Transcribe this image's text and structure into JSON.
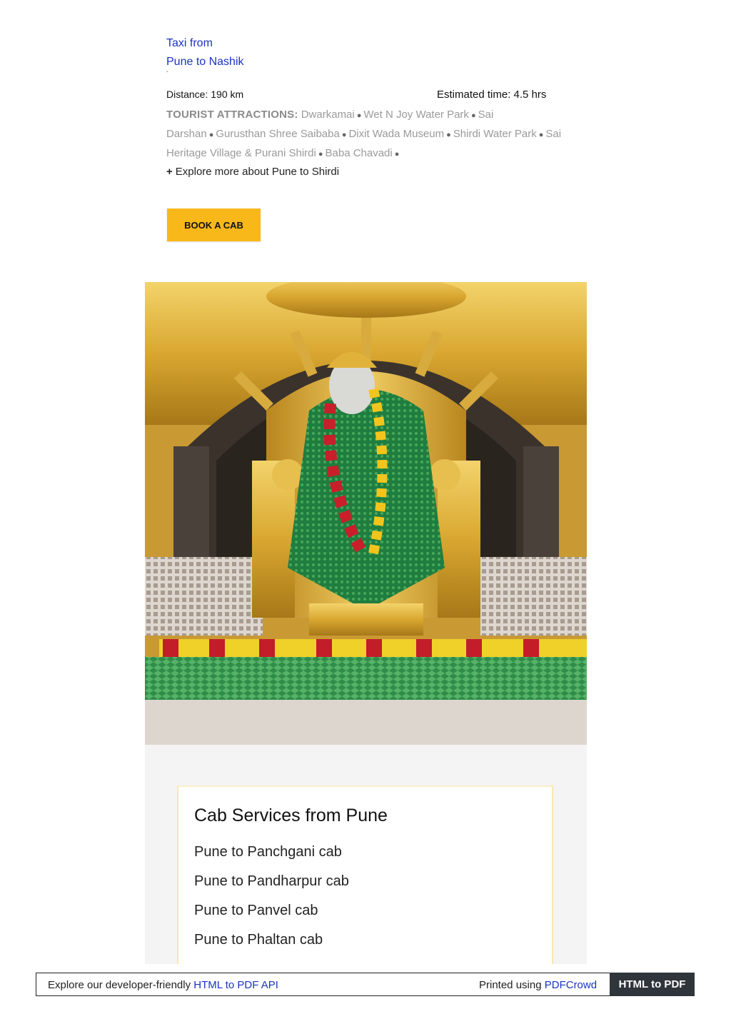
{
  "header": {
    "taxi_link_line1": "Taxi from",
    "taxi_link_line2": "Pune to Nashik"
  },
  "trip": {
    "distance": "Distance: 190 km",
    "estimated_time": "Estimated time: 4.5 hrs",
    "attractions_label": "TOURIST ATTRACTIONS:",
    "attractions": [
      "Dwarkamai",
      "Wet N Joy Water Park",
      "Sai Darshan",
      "Gurusthan Shree Saibaba",
      "Dixit Wada Museum",
      "Shirdi Water Park",
      "Sai Heritage Village & Purani Shirdi",
      "Baba Chavadi"
    ],
    "explore_more": "Explore more about Pune to Shirdi",
    "book_button": "BOOK A CAB"
  },
  "cab_services": {
    "title": "Cab Services from Pune",
    "links": [
      "Pune to Panchgani cab",
      "Pune to Pandharpur cab",
      "Pune to Panvel cab",
      "Pune to Phaltan cab"
    ]
  },
  "footer": {
    "left_text": "Explore our developer-friendly",
    "left_link": "HTML to PDF API",
    "right_text": "Printed using",
    "right_link": "PDFCrowd",
    "badge": "HTML to PDF"
  },
  "colors": {
    "link": "#1a33c0",
    "button": "#f9b81a",
    "badge_bg": "#2f353b"
  }
}
